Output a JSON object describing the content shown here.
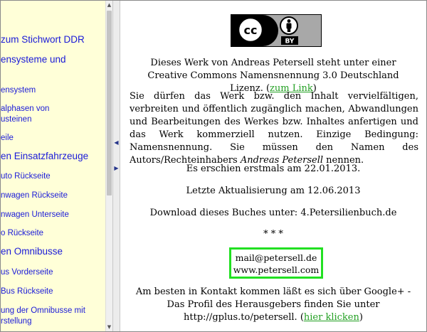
{
  "sidebar": {
    "items": [
      {
        "label": "zum Stichwort DDR",
        "big": true
      },
      {
        "label": "ensysteme und",
        "big": true
      },
      {
        "label": "ensystem",
        "big": false
      },
      {
        "label": "alphasen von",
        "big": false
      },
      {
        "label": "usteinen",
        "big": false
      },
      {
        "label": "eile",
        "big": false
      },
      {
        "label": "en Einsatzfahrzeuge",
        "big": true
      },
      {
        "label": "uto Rückseite",
        "big": false
      },
      {
        "label": "nwagen Rückseite",
        "big": false
      },
      {
        "label": "nwagen Unterseite",
        "big": false
      },
      {
        "label": "o Rückseite",
        "big": false
      },
      {
        "label": "en Omnibusse",
        "big": true
      },
      {
        "label": "us Vorderseite",
        "big": false
      },
      {
        "label": "Bus Rückseite",
        "big": false
      },
      {
        "label": "ung der Omnibusse mit",
        "big": false
      },
      {
        "label": "rstellung",
        "big": false
      }
    ]
  },
  "splitter": {
    "left_arrow": "◀",
    "right_arrow": "▶"
  },
  "badge": {
    "cc": "cc",
    "by": "BY"
  },
  "content": {
    "license_text": "Dieses Werk von Andreas Petersell steht unter einer Creative Commons Namensnennung 3.0 Deutschland Lizenz. (",
    "license_link": "zum Link",
    "license_close": ")",
    "permission_main": "Sie dürfen das Werk bzw. den Inhalt vervielfältigen, verbreiten und öffentlich zugänglich machen, Abwandlungen und Bearbeitungen des Werkes bzw. Inhaltes anfertigen und das Werk kommerziell nutzen. Einzige Bedingung: Namensnennung. Sie müssen den Namen des Autors/Rechteinhabers ",
    "author_italic": "Andreas Petersell",
    "permission_end": " nennen.",
    "first_published": "Es erschien erstmals am 22.01.2013.",
    "last_update": "Letzte Aktualisierung am 12.06.2013",
    "download": "Download dieses Buches unter: 4.Petersilienbuch.de",
    "stars": "* * *",
    "email": "mail@petersell.de",
    "website": "www.petersell.com",
    "contact_text": "Am besten in Kontakt kommen läßt es sich über Google+ - Das Profil des Herausgebers finden Sie unter http://gplus.to/petersell. (",
    "contact_link": "hier klicken",
    "contact_close": ")"
  },
  "colors": {
    "sidebar_bg": "#ffffd8",
    "nav_link": "#1a1ad8",
    "content_link": "#23a023",
    "highlight_border": "#22e022"
  }
}
